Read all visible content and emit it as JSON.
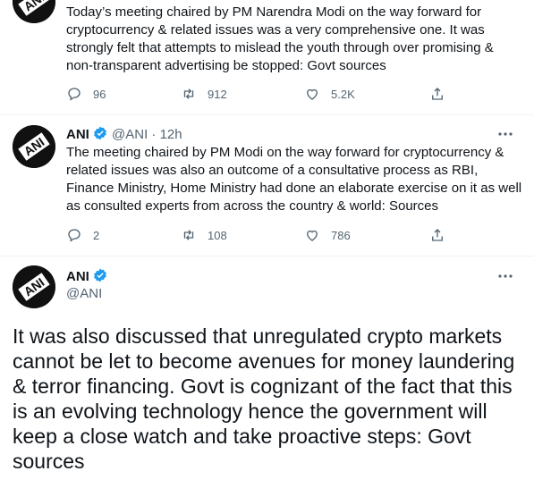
{
  "tweets": [
    {
      "text": "Today’s meeting chaired by PM Narendra Modi on the way forward for cryptocurrency & related issues was a very comprehensive one. It was strongly felt that attempts to mislead the youth through over promising & non-transparent advertising be stopped: Govt sources",
      "replies": "96",
      "retweets": "912",
      "likes": "5.2K"
    },
    {
      "name": "ANI",
      "handle": "@ANI",
      "time": "· 12h",
      "text": "The meeting chaired by PM Modi on the way forward for cryptocurrency & related issues was also an outcome of a consultative process as RBI, Finance Ministry, Home Ministry had done an elaborate exercise on it as well as consulted experts from across the country & world: Sources",
      "replies": "2",
      "retweets": "108",
      "likes": "786"
    },
    {
      "name": "ANI",
      "handle": "@ANI",
      "text": "It was also discussed that unregulated crypto markets cannot be let to become avenues for money laundering & terror financing. Govt is cognizant of the fact that this is an evolving technology hence the government will keep a close watch and take proactive steps: Govt sources"
    }
  ],
  "avatar_label": "ANI",
  "colors": {
    "verified": "#1d9bf0",
    "muted": "#536471",
    "text": "#0f1419"
  }
}
